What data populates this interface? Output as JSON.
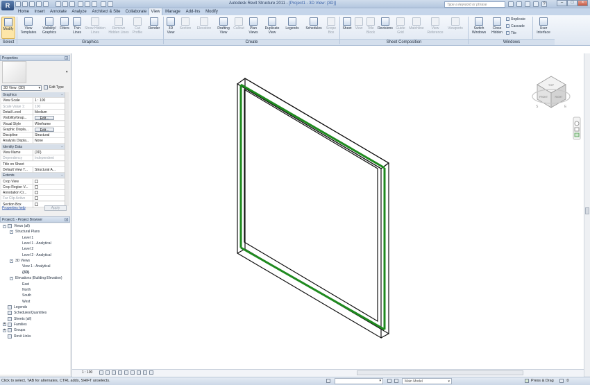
{
  "titlebar": {
    "app_button": "R",
    "title_prefix": "Autodesk Revit Structure 2011 - ",
    "title_doc": "[Project1 - 3D View: {3D}]",
    "search_placeholder": "Type a keyword or phrase",
    "help_label": "?"
  },
  "tabs": [
    {
      "label": "Home"
    },
    {
      "label": "Insert"
    },
    {
      "label": "Annotate"
    },
    {
      "label": "Analyze"
    },
    {
      "label": "Architect & Site"
    },
    {
      "label": "Collaborate"
    },
    {
      "label": "View",
      "active": true
    },
    {
      "label": "Manage"
    },
    {
      "label": "Add-Ins"
    },
    {
      "label": "Modify"
    }
  ],
  "ribbon": {
    "buttons": [
      {
        "label": "Modify",
        "icon": "cursor-arrow-icon",
        "active": true
      },
      {
        "label": "View Templates",
        "icon": "view-templates-icon"
      },
      {
        "label": "Visibility/ Graphics",
        "icon": "visibility-graphics-icon"
      },
      {
        "label": "Filters",
        "icon": "filters-icon"
      },
      {
        "label": "Thin Lines",
        "icon": "thin-lines-icon"
      },
      {
        "label": "Show Hidden Lines",
        "icon": "show-hidden-lines-icon",
        "disabled": true
      },
      {
        "label": "Remove Hidden Lines",
        "icon": "remove-hidden-lines-icon",
        "disabled": true
      },
      {
        "label": "Cut Profile",
        "icon": "cut-profile-icon",
        "disabled": true
      },
      {
        "label": "Render",
        "icon": "render-teapot-icon"
      },
      {
        "label": "3D View",
        "icon": "3d-view-house-icon"
      },
      {
        "label": "Section",
        "icon": "section-icon",
        "disabled": true
      },
      {
        "label": "Elevation",
        "icon": "elevation-icon",
        "disabled": true
      },
      {
        "label": "Drafting View",
        "icon": "drafting-view-icon"
      },
      {
        "label": "Callout",
        "icon": "callout-icon",
        "disabled": true
      },
      {
        "label": "Plan Views",
        "icon": "plan-views-icon"
      },
      {
        "label": "Duplicate View",
        "icon": "duplicate-view-icon"
      },
      {
        "label": "Legends",
        "icon": "legends-icon"
      },
      {
        "label": "Schedules",
        "icon": "schedules-icon"
      },
      {
        "label": "Scope Box",
        "icon": "scope-box-icon",
        "disabled": true
      },
      {
        "label": "Sheet",
        "icon": "sheet-icon"
      },
      {
        "label": "View",
        "icon": "place-view-icon",
        "disabled": true
      },
      {
        "label": "Title Block",
        "icon": "title-block-icon",
        "disabled": true
      },
      {
        "label": "Revisions",
        "icon": "revisions-icon"
      },
      {
        "label": "Guide Grid",
        "icon": "guide-grid-icon",
        "disabled": true
      },
      {
        "label": "Matchline",
        "icon": "matchline-icon",
        "disabled": true
      },
      {
        "label": "View Reference",
        "icon": "view-reference-icon",
        "disabled": true
      },
      {
        "label": "Viewports",
        "icon": "viewports-icon",
        "disabled": true
      },
      {
        "label": "Switch Windows",
        "icon": "switch-windows-icon"
      },
      {
        "label": "Close Hidden",
        "icon": "close-hidden-icon"
      },
      {
        "label": "User Interface",
        "icon": "user-interface-icon"
      }
    ],
    "windows_list": [
      "Replicate",
      "Cascade",
      "Tile"
    ],
    "groups": [
      "Select",
      "Graphics",
      "Create",
      "Sheet Composition",
      "Windows"
    ]
  },
  "properties": {
    "header": "Properties",
    "type_selector": "3D View: {3D}",
    "edit_type": "Edit Type",
    "sections": {
      "graphics": "Graphics",
      "identity": "Identity Data",
      "extents": "Extents"
    },
    "rows_graphics": [
      {
        "k": "View Scale",
        "v": "1 : 100"
      },
      {
        "k": "Scale Value    1:",
        "v": "100",
        "dis": true
      },
      {
        "k": "Detail Level",
        "v": "Medium"
      },
      {
        "k": "Visibility/Grap...",
        "v": "Edit...",
        "btn": true
      },
      {
        "k": "Visual Style",
        "v": "Wireframe"
      },
      {
        "k": "Graphic Displa...",
        "v": "Edit...",
        "btn": true
      },
      {
        "k": "Discipline",
        "v": "Structural"
      },
      {
        "k": "Analysis Displa...",
        "v": "None"
      }
    ],
    "rows_identity": [
      {
        "k": "View Name",
        "v": "{3D}"
      },
      {
        "k": "Dependency",
        "v": "Independent",
        "dis": true
      },
      {
        "k": "Title on Sheet",
        "v": ""
      },
      {
        "k": "Default View T...",
        "v": "Structural A..."
      }
    ],
    "rows_extents": [
      {
        "k": "Crop View",
        "chk": true
      },
      {
        "k": "Crop Region V...",
        "chk": true
      },
      {
        "k": "Annotation Cr...",
        "chk": true
      },
      {
        "k": "Far Clip Active",
        "chk": true,
        "dis": true
      },
      {
        "k": "Section Box",
        "chk": true
      }
    ],
    "help_link": "Properties help",
    "apply": "Apply"
  },
  "browser": {
    "header": "Project1 - Project Browser",
    "items": [
      {
        "label": "Views (all)",
        "level": 0,
        "tog": "-"
      },
      {
        "label": "Structural Plans",
        "level": 1,
        "tog": "-"
      },
      {
        "label": "Level 1",
        "level": 2
      },
      {
        "label": "Level 1 - Analytical",
        "level": 2
      },
      {
        "label": "Level 2",
        "level": 2
      },
      {
        "label": "Level 2 - Analytical",
        "level": 2
      },
      {
        "label": "3D Views",
        "level": 1,
        "tog": "-"
      },
      {
        "label": "View 1 - Analytical",
        "level": 2
      },
      {
        "label": "{3D}",
        "level": 2,
        "bold": true
      },
      {
        "label": "Elevations (Building Elevation)",
        "level": 1,
        "tog": "-"
      },
      {
        "label": "East",
        "level": 2
      },
      {
        "label": "North",
        "level": 2
      },
      {
        "label": "South",
        "level": 2
      },
      {
        "label": "West",
        "level": 2
      },
      {
        "label": "Legends",
        "level": 0,
        "icon": true
      },
      {
        "label": "Schedules/Quantities",
        "level": 0,
        "icon": true
      },
      {
        "label": "Sheets (all)",
        "level": 0,
        "icon": true
      },
      {
        "label": "Families",
        "level": 0,
        "tog": "+",
        "icon": true
      },
      {
        "label": "Groups",
        "level": 0,
        "tog": "+",
        "icon": true
      },
      {
        "label": "Revit Links",
        "level": 0,
        "icon": true
      }
    ]
  },
  "viewcube": {
    "top": "TOP",
    "front": "FRONT",
    "right": "RIGHT"
  },
  "view_control": {
    "scale": "1 : 100"
  },
  "status": {
    "message": "Click to select, TAB for alternates, CTRL adds, SHIFT unselects.",
    "model": "Main Model",
    "press_drag": "Press & Drag",
    "filter_count": ":0"
  },
  "colors": {
    "frame_green": "#1f8a1f",
    "accent": "#3a62a8"
  }
}
